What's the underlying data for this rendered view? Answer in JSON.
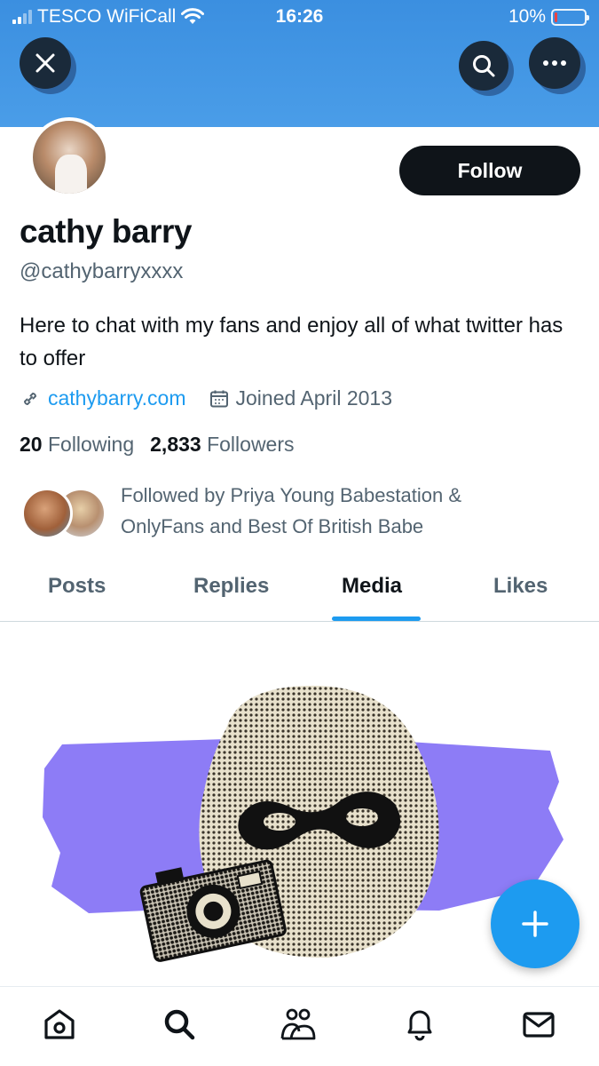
{
  "status_bar": {
    "carrier": "TESCO WiFiCall",
    "time": "16:26",
    "battery": "10%",
    "battery_level": 0.1
  },
  "header": {
    "close_icon": "close-icon",
    "search_icon": "search-icon",
    "more_icon": "more-icon"
  },
  "profile": {
    "display_name": "cathy barry",
    "handle": "@cathybarryxxxx",
    "follow_label": "Follow",
    "bio": "Here to chat with my fans and enjoy all of what twitter has to offer",
    "website": "cathybarry.com",
    "joined": "Joined April 2013",
    "following_count": "20",
    "following_label": "Following",
    "followers_count": "2,833",
    "followers_label": "Followers",
    "followed_by": "Followed by Priya Young Babestation & OnlyFans and Best Of British Babe"
  },
  "tabs": [
    {
      "label": "Posts",
      "active": false
    },
    {
      "label": "Replies",
      "active": false
    },
    {
      "label": "Media",
      "active": true
    },
    {
      "label": "Likes",
      "active": false
    }
  ],
  "colors": {
    "accent": "#1d9bf0",
    "banner": "#4a9de8",
    "illustration_purple": "#8d7cf6"
  },
  "bottom_nav": [
    "home-icon",
    "search-icon",
    "communities-icon",
    "notifications-icon",
    "messages-icon"
  ]
}
